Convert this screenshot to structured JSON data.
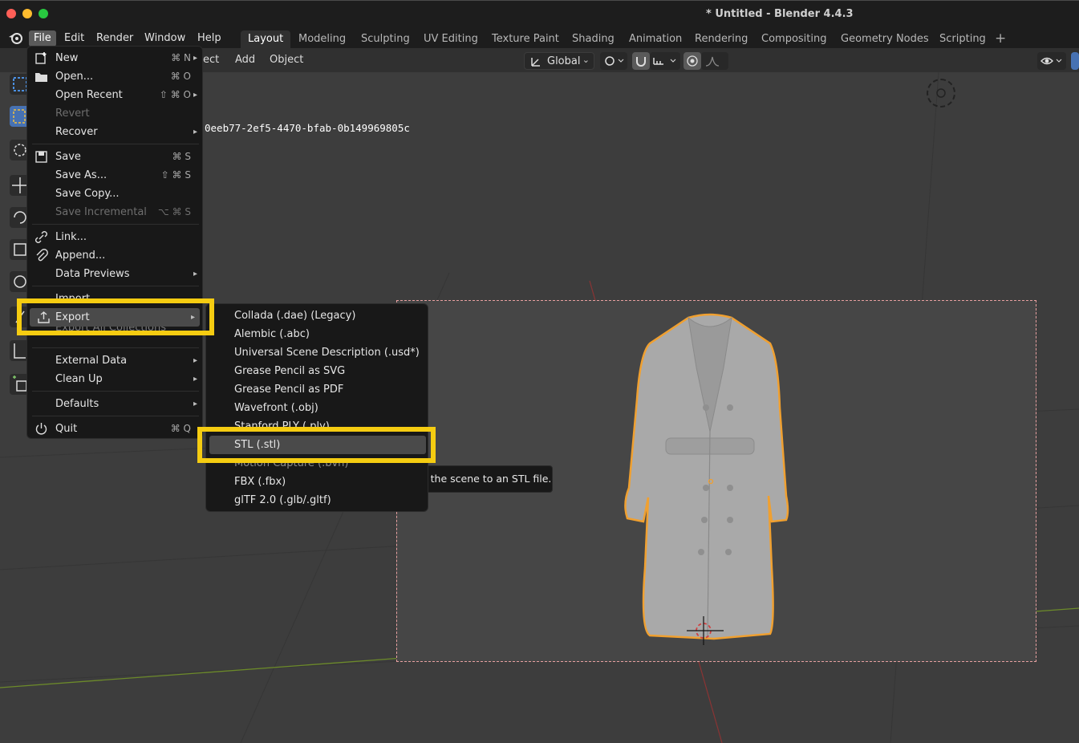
{
  "window": {
    "title": "* Untitled - Blender 4.4.3"
  },
  "menubar": {
    "items": [
      "File",
      "Edit",
      "Render",
      "Window",
      "Help"
    ],
    "workspaces": [
      "Layout",
      "Modeling",
      "Sculpting",
      "UV Editing",
      "Texture Paint",
      "Shading",
      "Animation",
      "Rendering",
      "Compositing",
      "Geometry Nodes",
      "Scripting"
    ],
    "active_workspace": "Layout",
    "add_tab": "+"
  },
  "header": {
    "select_partial": "ect",
    "add": "Add",
    "object": "Object",
    "orientation": "Global"
  },
  "viewport": {
    "object_id_partial": "0eeb77-2ef5-4470-bfab-0b149969805c",
    "tooltip": "Save the scene to an STL file."
  },
  "file_menu": {
    "new": {
      "label": "New",
      "shortcut": "⌘ N"
    },
    "open": {
      "label": "Open...",
      "shortcut": "⌘ O"
    },
    "open_recent": {
      "label": "Open Recent",
      "shortcut": "⇧ ⌘ O"
    },
    "revert": {
      "label": "Revert"
    },
    "recover": {
      "label": "Recover"
    },
    "save": {
      "label": "Save",
      "shortcut": "⌘ S"
    },
    "save_as": {
      "label": "Save As...",
      "shortcut": "⇧ ⌘ S"
    },
    "save_copy": {
      "label": "Save Copy..."
    },
    "save_incremental": {
      "label": "Save Incremental",
      "shortcut": "⌥ ⌘ S"
    },
    "link": {
      "label": "Link..."
    },
    "append": {
      "label": "Append..."
    },
    "data_previews": {
      "label": "Data Previews"
    },
    "import": {
      "label": "Import"
    },
    "export": {
      "label": "Export"
    },
    "export_all_collections": {
      "label": "Export All Collections"
    },
    "external_data": {
      "label": "External Data"
    },
    "clean_up": {
      "label": "Clean Up"
    },
    "defaults": {
      "label": "Defaults"
    },
    "quit": {
      "label": "Quit",
      "shortcut": "⌘ Q"
    }
  },
  "export_menu": {
    "items": [
      "Collada (.dae) (Legacy)",
      "Alembic (.abc)",
      "Universal Scene Description (.usd*)",
      "Grease Pencil as SVG",
      "Grease Pencil as PDF",
      "Wavefront (.obj)",
      "Stanford PLY (.ply)",
      "STL (.stl)",
      "Motion Capture (.bvh)",
      "FBX (.fbx)",
      "glTF 2.0 (.glb/.gltf)"
    ],
    "highlighted": "STL (.stl)"
  },
  "colors": {
    "highlight_box": "#f5cc11",
    "selection_outline": "#f0a030",
    "menu_bg": "#181818",
    "active_tool": "#4772b3"
  }
}
